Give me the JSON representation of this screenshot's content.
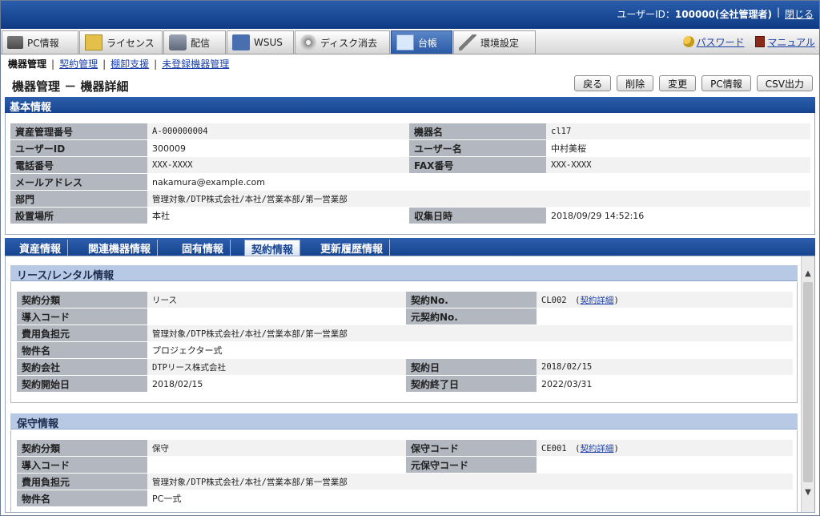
{
  "header": {
    "user_label": "ユーザーID：",
    "user_value": "100000(全社管理者)",
    "separator": "|",
    "logout": "閉じる"
  },
  "nav": {
    "tabs": [
      {
        "label": "PC情報",
        "icon": "pc-icon"
      },
      {
        "label": "ライセンス",
        "icon": "license-icon"
      },
      {
        "label": "配信",
        "icon": "distribution-icon"
      },
      {
        "label": "WSUS",
        "icon": "wsus-icon"
      },
      {
        "label": "ディスク消去",
        "icon": "disk-erase-icon"
      },
      {
        "label": "台帳",
        "icon": "ledger-icon"
      },
      {
        "label": "環境設定",
        "icon": "settings-tools-icon"
      }
    ],
    "password": "パスワード",
    "manual": "マニュアル"
  },
  "subnav": {
    "current": "機器管理",
    "items": [
      "契約管理",
      "棚卸支援",
      "未登録機器管理"
    ],
    "sep": "|"
  },
  "page": {
    "title": "機器管理 － 機器詳細",
    "buttons": [
      "戻る",
      "削除",
      "変更",
      "PC情報",
      "CSV出力"
    ]
  },
  "basic": {
    "title": "基本情報",
    "rows": [
      {
        "l1": "資産管理番号",
        "v1": "A-000000004",
        "l2": "機器名",
        "v2": "cl17"
      },
      {
        "l1": "ユーザーID",
        "v1": "300009",
        "l2": "ユーザー名",
        "v2": "中村美桜"
      },
      {
        "l1": "電話番号",
        "v1": "XXX-XXXX",
        "l2": "FAX番号",
        "v2": "XXX-XXXX"
      },
      {
        "l1": "メールアドレス",
        "v1": "nakamura@example.com"
      },
      {
        "l1": "部門",
        "v1": "管理対象/DTP株式会社/本社/営業本部/第一営業部"
      },
      {
        "l1": "設置場所",
        "v1": "本社",
        "l2": "収集日時",
        "v2": "2018/09/29 14:52:16"
      }
    ]
  },
  "tabs": {
    "items": [
      "資産情報",
      "関連機器情報",
      "固有情報",
      "契約情報",
      "更新履歴情報"
    ],
    "active": 3
  },
  "lease": {
    "title": "リース/レンタル情報",
    "rows": [
      {
        "l1": "契約分類",
        "v1": "リース",
        "l2": "契約No.",
        "v2": "CL002",
        "link": "契約詳細"
      },
      {
        "l1": "導入コード",
        "v1": "",
        "l2": "元契約No.",
        "v2": ""
      },
      {
        "l1": "費用負担元",
        "v1": "管理対象/DTP株式会社/本社/営業本部/第一営業部"
      },
      {
        "l1": "物件名",
        "v1": "プロジェクター式"
      },
      {
        "l1": "契約会社",
        "v1": "DTPリース株式会社",
        "l2": "契約日",
        "v2": "2018/02/15"
      },
      {
        "l1": "契約開始日",
        "v1": "2018/02/15",
        "l2": "契約終了日",
        "v2": "2022/03/31"
      }
    ]
  },
  "maintenance": {
    "title": "保守情報",
    "rows": [
      {
        "l1": "契約分類",
        "v1": "保守",
        "l2": "保守コード",
        "v2": "CE001",
        "link": "契約詳細"
      },
      {
        "l1": "導入コード",
        "v1": "",
        "l2": "元保守コード",
        "v2": ""
      },
      {
        "l1": "費用負担元",
        "v1": "管理対象/DTP株式会社/本社/営業本部/第一営業部"
      },
      {
        "l1": "物件名",
        "v1": "PC一式"
      }
    ]
  }
}
